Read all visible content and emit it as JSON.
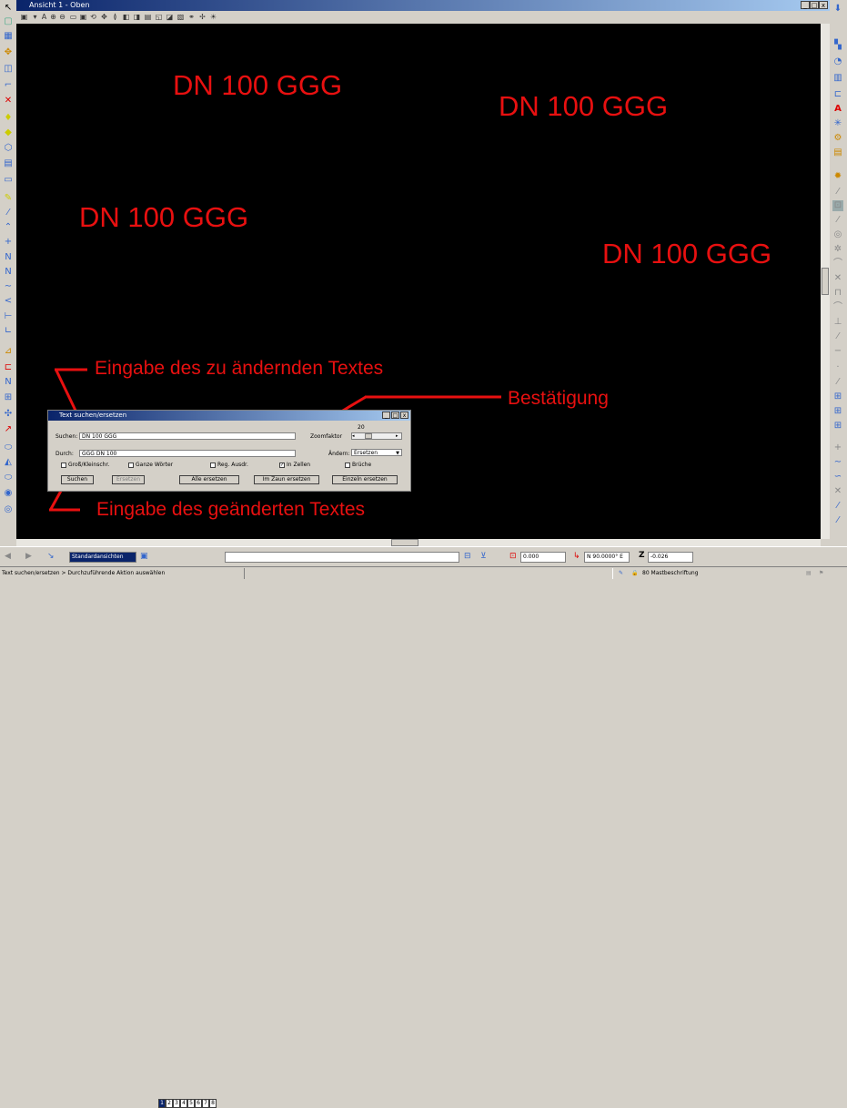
{
  "window": {
    "title": "Ansicht 1 - Oben",
    "minimize": "_",
    "restore": "□",
    "close": "x"
  },
  "drawing_texts": [
    "DN 100 GGG",
    "DN 100 GGG",
    "DN 100 GGG",
    "DN 100 GGG"
  ],
  "annotations": {
    "search_hint": "Eingabe des zu ändernden Textes",
    "confirm_hint": "Bestätigung",
    "replace_hint": "Eingabe des geänderten Textes"
  },
  "dialog": {
    "title": "Text suchen/ersetzen",
    "search_label": "Suchen:",
    "search_value": "DN 100 GGG",
    "replace_label": "Durch:",
    "replace_value": "GGG DN 100",
    "zoom_label": "Zoomfaktor",
    "zoom_value": "20",
    "change_label": "Ändern:",
    "change_value": "Ersetzen",
    "options": [
      {
        "label": "Groß/Kleinschr.",
        "checked": false
      },
      {
        "label": "Ganze Wörter",
        "checked": false
      },
      {
        "label": "Reg. Ausdr.",
        "checked": false
      },
      {
        "label": "In Zellen",
        "checked": true
      },
      {
        "label": "Brüche",
        "checked": false
      }
    ],
    "buttons": {
      "search": "Suchen",
      "replace": "Ersetzen",
      "replace_all": "Alle ersetzen",
      "replace_fence": "Im Zaun ersetzen",
      "replace_single": "Einzeln ersetzen"
    }
  },
  "statusbar": {
    "views_dropdown": "Standardansichten",
    "view_numbers": [
      "1",
      "2",
      "3",
      "4",
      "5",
      "6",
      "7",
      "8"
    ],
    "coord_x": "0.000",
    "angle": "N 90.0000° E",
    "z_label": "Z",
    "z_value": "-0.026",
    "prompt": "Text suchen/ersetzen > Durchzuführende Aktion auswählen",
    "level": "80 Mastbeschriftung"
  },
  "colors": {
    "drawing_text": "#e81010",
    "canvas": "#000000",
    "title_gradient_start": "#0a246a"
  }
}
